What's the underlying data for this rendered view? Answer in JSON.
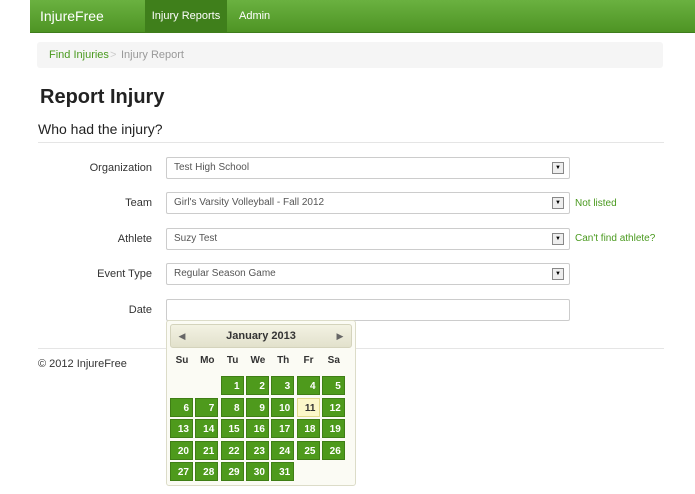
{
  "nav": {
    "brand": "InjureFree",
    "items": [
      "Injury Reports",
      "Admin"
    ]
  },
  "breadcrumb": {
    "link": "Find Injuries",
    "separator": ">",
    "current": "Injury Report"
  },
  "page": {
    "title": "Report Injury",
    "subtitle": "Who had the injury?"
  },
  "form": {
    "organization": {
      "label": "Organization",
      "value": "Test High School"
    },
    "team": {
      "label": "Team",
      "value": "Girl's Varsity Volleyball - Fall 2012",
      "help": "Not listed"
    },
    "athlete": {
      "label": "Athlete",
      "value": "Suzy Test",
      "help": "Can't find athlete?"
    },
    "event_type": {
      "label": "Event Type",
      "value": "Regular Season Game"
    },
    "date": {
      "label": "Date",
      "value": ""
    }
  },
  "datepicker": {
    "title": "January 2013",
    "weekdays": [
      "Su",
      "Mo",
      "Tu",
      "We",
      "Th",
      "Fr",
      "Sa"
    ],
    "first_weekday_index": 2,
    "days_in_month": 31,
    "today": 11
  },
  "footer": {
    "copyright": "© 2012 InjureFree"
  },
  "colors": {
    "nav_green": "#5aa22f",
    "day_green": "#4e9a1c",
    "link_green": "#4a9a1f"
  }
}
